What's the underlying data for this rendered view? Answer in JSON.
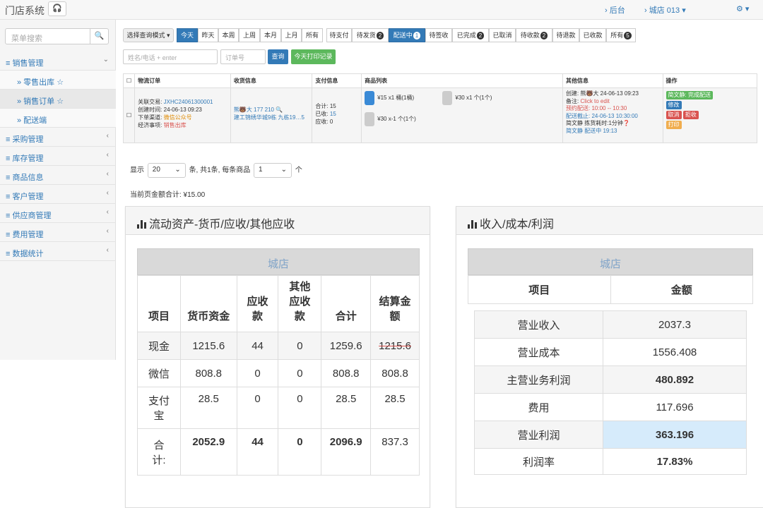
{
  "topbar": {
    "title": "门店系统",
    "headphone_icon": "headphone-icon",
    "backend": "› 后台",
    "store": "› 城店 013",
    "store_suffix": "▾",
    "settings": "⚙ ▾"
  },
  "sidebar": {
    "search_placeholder": "菜单搜索",
    "items": [
      {
        "label": "≡ 销售管理",
        "arrow": "⌄"
      },
      {
        "label": "» 零售出库 ☆"
      },
      {
        "label": "» 销售订单 ☆"
      },
      {
        "label": "» 配送端"
      },
      {
        "label": "≡ 采购管理",
        "arrow": "‹"
      },
      {
        "label": "≡ 库存管理",
        "arrow": "‹"
      },
      {
        "label": "≡ 商品信息",
        "arrow": "‹"
      },
      {
        "label": "≡ 客户管理",
        "arrow": "‹"
      },
      {
        "label": "≡ 供应商管理",
        "arrow": "‹"
      },
      {
        "label": "≡ 费用管理",
        "arrow": "‹"
      },
      {
        "label": "≡ 数据统计",
        "arrow": "‹"
      }
    ]
  },
  "filters": {
    "mode": "选择查询模式 ▾",
    "time": [
      "今天",
      "昨天",
      "本周",
      "上周",
      "本月",
      "上月",
      "所有"
    ],
    "status": [
      {
        "label": "待支付",
        "badge": ""
      },
      {
        "label": "待发货",
        "badge": "2"
      },
      {
        "label": "配送中",
        "badge": "1"
      },
      {
        "label": "待签收",
        "badge": ""
      },
      {
        "label": "已完成",
        "badge": "2"
      },
      {
        "label": "已取消",
        "badge": ""
      },
      {
        "label": "待收款",
        "badge": "2"
      },
      {
        "label": "待退款",
        "badge": ""
      },
      {
        "label": "已收款",
        "badge": ""
      },
      {
        "label": "所有",
        "badge": "5"
      }
    ],
    "name_placeholder": "姓名/电话 + enter",
    "order_placeholder": "订单号",
    "query": "查询",
    "print_log": "今天打印记录"
  },
  "orders": {
    "headers": [
      "物流订单",
      "收货信息",
      "支付信息",
      "商品列表",
      "其他信息",
      "操作"
    ],
    "row": {
      "trade_label": "关联交易:",
      "trade_no": "JXHC24061300001",
      "created": "创建时间: 24-06-13 09:23",
      "channel_label": "下单渠道:",
      "channel": "微信公众号",
      "affair_label": "经济事项:",
      "affair": "销售出库",
      "receiver": "熊🐻大 177       210 🔍",
      "address": "建工锦绣华城9栋 九栋19…5",
      "pay_total": "合计: 15",
      "pay_paid_label": "已收:",
      "pay_paid": "15",
      "pay_due": "应收: 0",
      "item1": "¥15 x1 桶(1桶)",
      "item2": "¥30 x1 个(1个)",
      "item3": "¥30 x-1 个(1个)",
      "other_created": "创建: 熊🐻大 24-06-13 09:23",
      "note_label": "备注:",
      "note": "Click to edit",
      "reserve": "预约配送: 10:00 -- 10:30",
      "deadline": "配送截止: 24-06-13 10:30:00",
      "picker": "简文静 拣货耗时:1分钟❓",
      "delivery": "简文静 配送中 19:13",
      "actions": {
        "complete": "简文静: 完成配送",
        "edit": "修改",
        "cancel": "取消",
        "reject": "拒收",
        "print": "打印"
      }
    }
  },
  "pager": {
    "show": "显示",
    "page_size": "20",
    "suffix": "条, 共1条,",
    "per_item": "每条商品",
    "item_count": "1",
    "unit": "个",
    "page_total": "当前页金额合计: ¥15.00"
  },
  "panel_left": {
    "title": "流动资产-货币/应收/其他应收",
    "store": "城店",
    "headers": [
      "项目",
      "货币资金",
      "应收款",
      "其他应收款",
      "合计",
      "结算金额"
    ],
    "rows": [
      [
        "现金",
        "1215.6",
        "44",
        "0",
        "1259.6",
        "1215.6"
      ],
      [
        "微信",
        "808.8",
        "0",
        "0",
        "808.8",
        "808.8"
      ],
      [
        "支付宝",
        "28.5",
        "0",
        "0",
        "28.5",
        "28.5"
      ],
      [
        "合计:",
        "2052.9",
        "44",
        "0",
        "2096.9",
        "837.3"
      ]
    ]
  },
  "panel_right": {
    "title": "收入/成本/利润",
    "store": "城店",
    "headers": [
      "项目",
      "金额"
    ],
    "rows": [
      [
        "营业收入",
        "2037.3"
      ],
      [
        "营业成本",
        "1556.408"
      ],
      [
        "主营业务利润",
        "480.892"
      ],
      [
        "费用",
        "117.696"
      ],
      [
        "营业利润",
        "363.196"
      ],
      [
        "利润率",
        "17.83%"
      ]
    ]
  }
}
